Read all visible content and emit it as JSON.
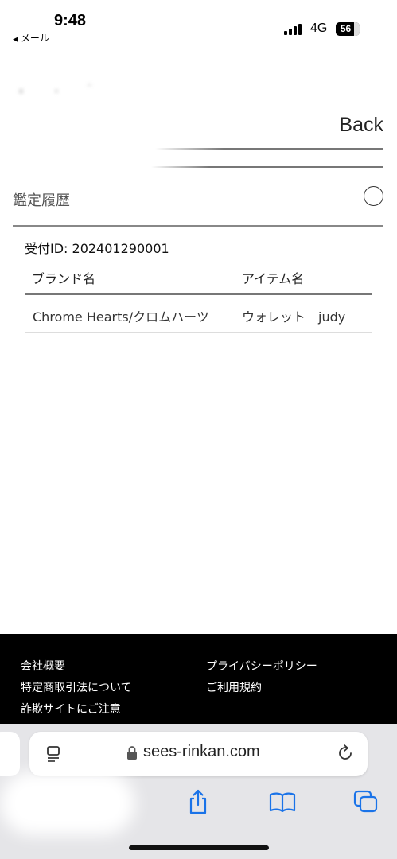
{
  "status": {
    "time": "9:48",
    "back_app": "メール",
    "network": "4G",
    "battery": "56"
  },
  "header": {
    "back_label": "Back"
  },
  "section": {
    "title": "鑑定履歴"
  },
  "record": {
    "receipt_label": "受付ID: 202401290001",
    "columns": [
      "ブランド名",
      "アイテム名"
    ],
    "rows": [
      [
        "Chrome Hearts/クロムハーツ",
        "ウォレット　judy"
      ]
    ]
  },
  "footer": {
    "links": [
      "会社概要",
      "特定商取引法について",
      "詐欺サイトにご注意",
      "プライバシーポリシー",
      "ご利用規約"
    ]
  },
  "browser": {
    "url": "sees-rinkan.com"
  },
  "colors": {
    "accent": "#1a73e8",
    "footer_bg": "#000000"
  }
}
